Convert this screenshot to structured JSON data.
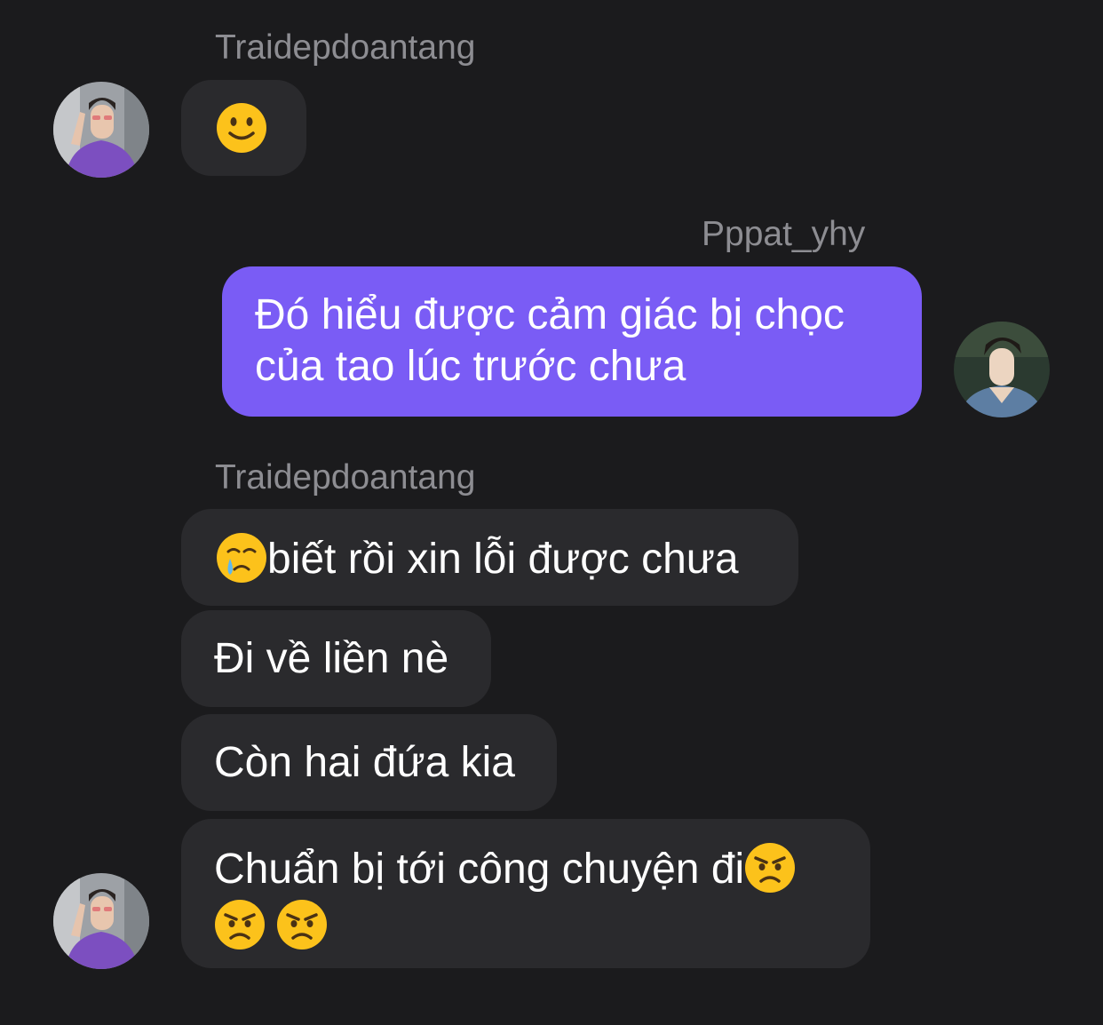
{
  "chat": {
    "groups": [
      {
        "sender": "Traidepdoantang",
        "direction": "incoming",
        "messages": [
          {
            "emoji": [
              "slightly-smiling-face"
            ]
          }
        ]
      },
      {
        "sender": "Pppat_yhy",
        "direction": "outgoing",
        "messages": [
          {
            "lines": [
              "Đó hiểu được cảm giác bị chọc",
              "của tao lúc trước chưa"
            ]
          }
        ]
      },
      {
        "sender": "Traidepdoantang",
        "direction": "incoming",
        "messages": [
          {
            "emoji_prefix": "face-holding-back-tears",
            "text": "biết rồi xin lỗi được chưa"
          },
          {
            "text": "Đi về liền nè"
          },
          {
            "text": "Còn hai đứa kia"
          },
          {
            "text": "Chuẩn bị tới công chuyện đi",
            "emoji_after_text": "angry-face",
            "emoji_next_line": [
              "angry-face",
              "angry-face"
            ]
          }
        ]
      }
    ],
    "colors": {
      "background": "#1b1b1d",
      "incoming_bubble": "#2a2a2d",
      "outgoing_bubble": "#7a5cf5",
      "sender_name": "#8d8d92",
      "message_text": "#ffffff"
    }
  }
}
